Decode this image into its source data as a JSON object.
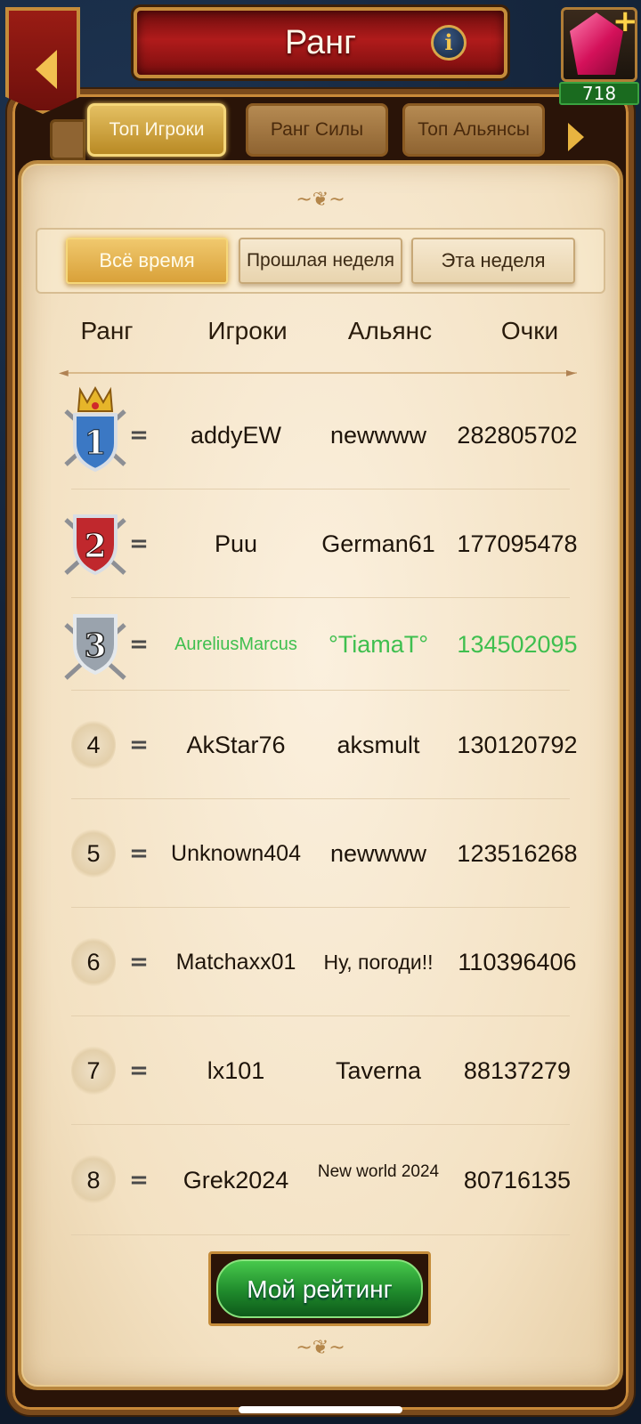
{
  "header": {
    "title": "Ранг",
    "info_label": "i",
    "gems": "718",
    "gem_plus": "+"
  },
  "tabs": [
    {
      "label": "Топ Игроки",
      "active": true
    },
    {
      "label": "Ранг Силы",
      "active": false
    },
    {
      "label": "Топ Альянсы",
      "active": false
    }
  ],
  "subtabs": [
    {
      "label": "Всё время",
      "active": true
    },
    {
      "label": "Прошлая неделя",
      "active": false
    },
    {
      "label": "Эта неделя",
      "active": false
    }
  ],
  "columns": {
    "rank": "Ранг",
    "players": "Игроки",
    "alliance": "Альянс",
    "score": "Очки"
  },
  "rows": [
    {
      "rank": "1",
      "trend": "=",
      "player": "addyEW",
      "alliance": "newwww",
      "score": "282805702"
    },
    {
      "rank": "2",
      "trend": "=",
      "player": "Puu",
      "alliance": "German61",
      "score": "177095478"
    },
    {
      "rank": "3",
      "trend": "=",
      "player": "AureliusMarcus",
      "alliance": "°TiamaT°",
      "score": "134502095"
    },
    {
      "rank": "4",
      "trend": "=",
      "player": "AkStar76",
      "alliance": "aksmult",
      "score": "130120792"
    },
    {
      "rank": "5",
      "trend": "=",
      "player": "Unknown404",
      "alliance": "newwww",
      "score": "123516268"
    },
    {
      "rank": "6",
      "trend": "=",
      "player": "Matchaxx01",
      "alliance": "Ну, погоди!!",
      "score": "110396406"
    },
    {
      "rank": "7",
      "trend": "=",
      "player": "lx101",
      "alliance": "Taverna",
      "score": "88137279"
    },
    {
      "rank": "8",
      "trend": "=",
      "player": "Grek2024",
      "alliance": "New world 2024",
      "score": "80716135"
    }
  ],
  "my_rating_button": "Мой рейтинг",
  "colors": {
    "highlight_row": "#3fbf4f",
    "badge_gold": "#d9a21c",
    "badge_blue": "#3b78c4",
    "badge_red": "#c0282d",
    "badge_silver": "#9aa3ad"
  },
  "icons": {
    "back": "chevron-left-icon",
    "info": "info-icon",
    "gem": "gem-icon",
    "next_tabs": "chevron-right-icon",
    "rank_1": "crown-shield-icon",
    "rank_2": "red-shield-icon",
    "rank_3": "silver-shield-icon"
  }
}
